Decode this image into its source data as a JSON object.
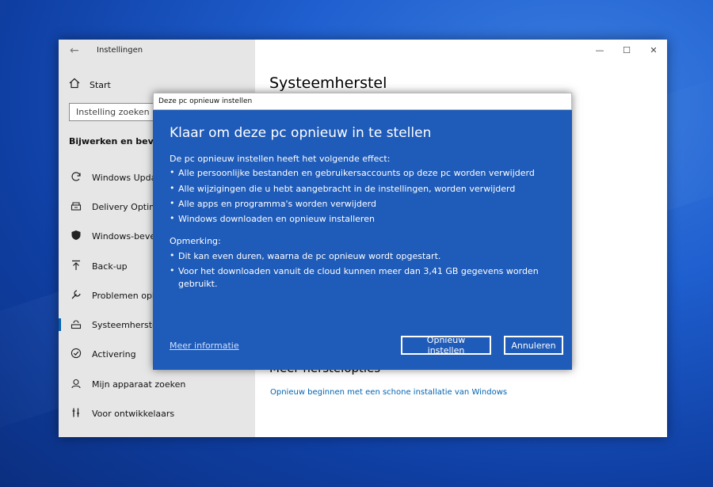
{
  "window": {
    "title": "Instellingen",
    "controls": {
      "minimize": "—",
      "maximize": "☐",
      "close": "✕"
    },
    "back_icon": "back-arrow-icon"
  },
  "sidebar": {
    "home_label": "Start",
    "search_placeholder": "Instelling zoeken",
    "section_title": "Bijwerken en beveiliging",
    "items": [
      {
        "label": "Windows Update",
        "icon": "sync-icon"
      },
      {
        "label": "Delivery Optimization",
        "icon": "delivery-icon"
      },
      {
        "label": "Windows-beveiliging",
        "icon": "shield-icon"
      },
      {
        "label": "Back-up",
        "icon": "backup-icon"
      },
      {
        "label": "Problemen oplossen",
        "icon": "wrench-icon"
      },
      {
        "label": "Systeemherstel",
        "icon": "restore-icon",
        "active": true
      },
      {
        "label": "Activering",
        "icon": "check-circle-icon"
      },
      {
        "label": "Mijn apparaat zoeken",
        "icon": "find-device-icon"
      },
      {
        "label": "Voor ontwikkelaars",
        "icon": "tools-icon"
      }
    ]
  },
  "main": {
    "title": "Systeemherstel",
    "more_options_heading": "Meer herstelopties",
    "clean_install_link": "Opnieuw beginnen met een schone installatie van Windows"
  },
  "dialog": {
    "title": "Deze pc opnieuw instellen",
    "heading": "Klaar om deze pc opnieuw in te stellen",
    "intro": "De pc opnieuw instellen heeft het volgende effect:",
    "effects": [
      "Alle persoonlijke bestanden en gebruikersaccounts op deze pc worden verwijderd",
      "Alle wijzigingen die u hebt aangebracht in de instellingen, worden verwijderd",
      "Alle apps en programma's worden verwijderd",
      "Windows downloaden en opnieuw installeren"
    ],
    "note_label": "Opmerking:",
    "notes": [
      "Dit kan even duren, waarna de pc opnieuw wordt opgestart.",
      "Voor het downloaden vanuit de cloud kunnen meer dan 3,41 GB gegevens worden gebruikt."
    ],
    "more_info_link": "Meer informatie",
    "reset_button": "Opnieuw instellen",
    "cancel_button": "Annuleren",
    "bullet_char": "•"
  },
  "colors": {
    "accent": "#0063b1",
    "dialog_bg": "#1f5bb8",
    "sidebar_bg": "#e6e6e6"
  }
}
